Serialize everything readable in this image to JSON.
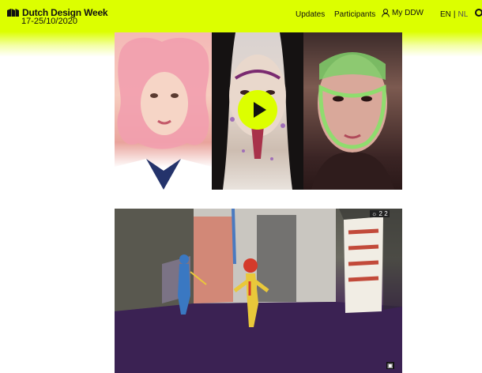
{
  "header": {
    "brand": "Dutch Design Week",
    "dates": "17-25/10/2020",
    "background_color": "#dcff00",
    "nav": {
      "updates": "Updates",
      "participants": "Participants",
      "my_ddw": "My DDW"
    },
    "language": {
      "en": "EN",
      "separator": "|",
      "nl": "NL"
    }
  },
  "video": {
    "play_button_color": "#dcff00",
    "play_icon": "play-icon"
  },
  "game": {
    "hud_text": "☼ 2 2",
    "corner_icon": "▣"
  },
  "icons": {
    "logo": "ddw-logo-icon",
    "user": "user-icon",
    "edge": "circle-icon"
  }
}
